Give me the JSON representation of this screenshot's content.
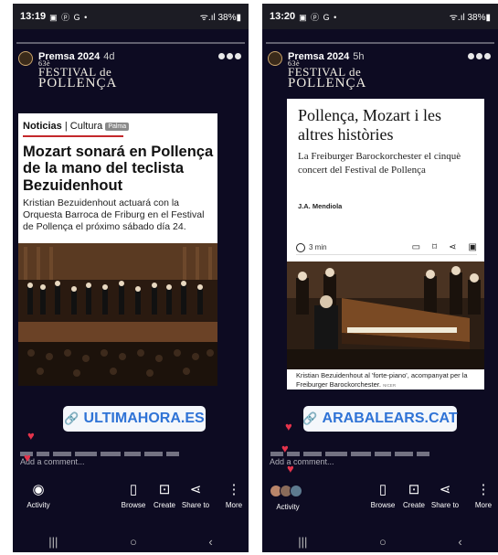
{
  "colors": {
    "story_bg": "#0d0b22",
    "link_blue": "#2f73d6",
    "heart_red": "#e5334b",
    "tag_red": "#c4282b"
  },
  "left": {
    "status": {
      "time": "13:19",
      "notif": "▣ ⓟ G •",
      "right": "ᯤ.ıl 38%▮"
    },
    "story": {
      "account": "Premsa 2024",
      "age": "4d",
      "festival_line1": "63è",
      "festival_line2": "FESTIVAL de",
      "festival_line3": "POLLENÇA"
    },
    "article": {
      "section": "Noticias",
      "category": "Cultura",
      "tag": "Palma",
      "headline": "Mozart sonará en Pollença de la mano del teclista Bezuidenhout",
      "subhead": "Kristian Bezuidenhout actuará con la Orquesta Barroca de Friburg en el Festival de Pollença el próximo sábado día 24."
    },
    "link": "ULTIMAHORA.ES",
    "comment_placeholder": "Add a comment..."
  },
  "right": {
    "status": {
      "time": "13:20",
      "notif": "▣ ⓟ G •",
      "right": "ᯤ.ıl 38%▮"
    },
    "story": {
      "account": "Premsa 2024",
      "age": "5h",
      "festival_line1": "63è",
      "festival_line2": "FESTIVAL de",
      "festival_line3": "POLLENÇA"
    },
    "article": {
      "headline": "Pollença, Mozart i les altres històries",
      "subhead": "La Freiburger Barockorchester el cinquè concert del Festival de Pollença",
      "author": "J.A. Mendiola",
      "read_time": "3 min",
      "caption": "Kristian Bezuidenhout al 'forte-piano', acompanyat per la Freiburger Barockorchester.",
      "caption_credit": "NICER"
    },
    "link": "ARABALEARS.CAT",
    "comment_placeholder": "Add a comment..."
  },
  "actions": {
    "activity": "Activity",
    "browse": "Browse",
    "create": "Create",
    "share": "Share to",
    "more": "More"
  },
  "icons": {
    "activity": "eye-icon",
    "browse": "browse-icon",
    "create": "create-icon",
    "share": "share-icon",
    "more": "more-vertical-icon"
  }
}
